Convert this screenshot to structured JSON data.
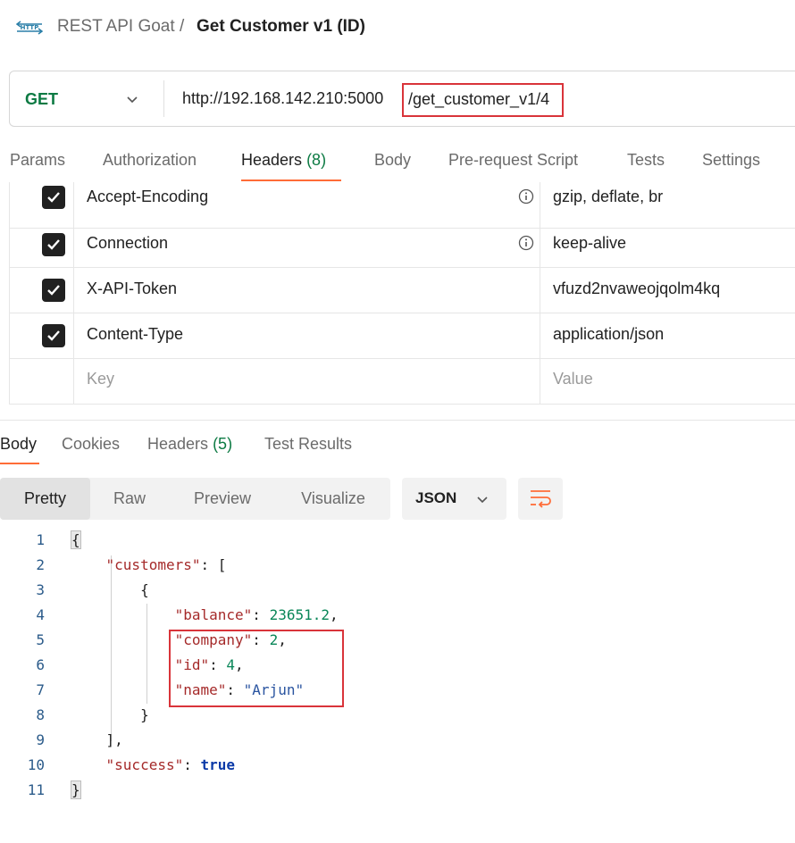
{
  "header": {
    "icon": "http-icon",
    "icon_text": "HTTP",
    "parent": "REST API Goat",
    "separator": "/",
    "current": "Get Customer v1 (ID)"
  },
  "request": {
    "method": "GET",
    "url_base": "http://192.168.142.210:5000",
    "url_path": "/get_customer_v1/4"
  },
  "request_tabs": [
    {
      "label": "Params"
    },
    {
      "label": "Authorization"
    },
    {
      "label": "Headers",
      "count": "(8)",
      "active": true
    },
    {
      "label": "Body"
    },
    {
      "label": "Pre-request Script"
    },
    {
      "label": "Tests"
    },
    {
      "label": "Settings"
    }
  ],
  "headers_table": {
    "rows": [
      {
        "checked": true,
        "key": "Accept-Encoding",
        "info": true,
        "value": "gzip, deflate, br"
      },
      {
        "checked": true,
        "key": "Connection",
        "info": true,
        "value": "keep-alive"
      },
      {
        "checked": true,
        "key": "X-API-Token",
        "info": false,
        "value": "vfuzd2nvaweojqolm4kq"
      },
      {
        "checked": true,
        "key": "Content-Type",
        "info": false,
        "value": "application/json"
      }
    ],
    "placeholder_key": "Key",
    "placeholder_value": "Value"
  },
  "response_tabs": [
    {
      "label": "Body",
      "active": true
    },
    {
      "label": "Cookies"
    },
    {
      "label": "Headers",
      "count": "(5)"
    },
    {
      "label": "Test Results"
    }
  ],
  "body_toolbar": {
    "views": [
      "Pretty",
      "Raw",
      "Preview",
      "Visualize"
    ],
    "active_view": "Pretty",
    "format": "JSON",
    "wrap_icon": "wrap-lines-icon"
  },
  "code": {
    "line_numbers": [
      "1",
      "2",
      "3",
      "4",
      "5",
      "6",
      "7",
      "8",
      "9",
      "10",
      "11"
    ],
    "open_brace": "{",
    "close_brace": "}",
    "customers_key": "\"customers\"",
    "balance_key": "\"balance\"",
    "balance_value": "23651.2",
    "company_key": "\"company\"",
    "company_value": "2",
    "id_key": "\"id\"",
    "id_value": "4",
    "name_key": "\"name\"",
    "name_value": "\"Arjun\"",
    "success_key": "\"success\"",
    "success_value": "true"
  },
  "colors": {
    "accent": "#ff6c37",
    "method_get": "#0c7a43",
    "highlight": "#d9343a"
  }
}
